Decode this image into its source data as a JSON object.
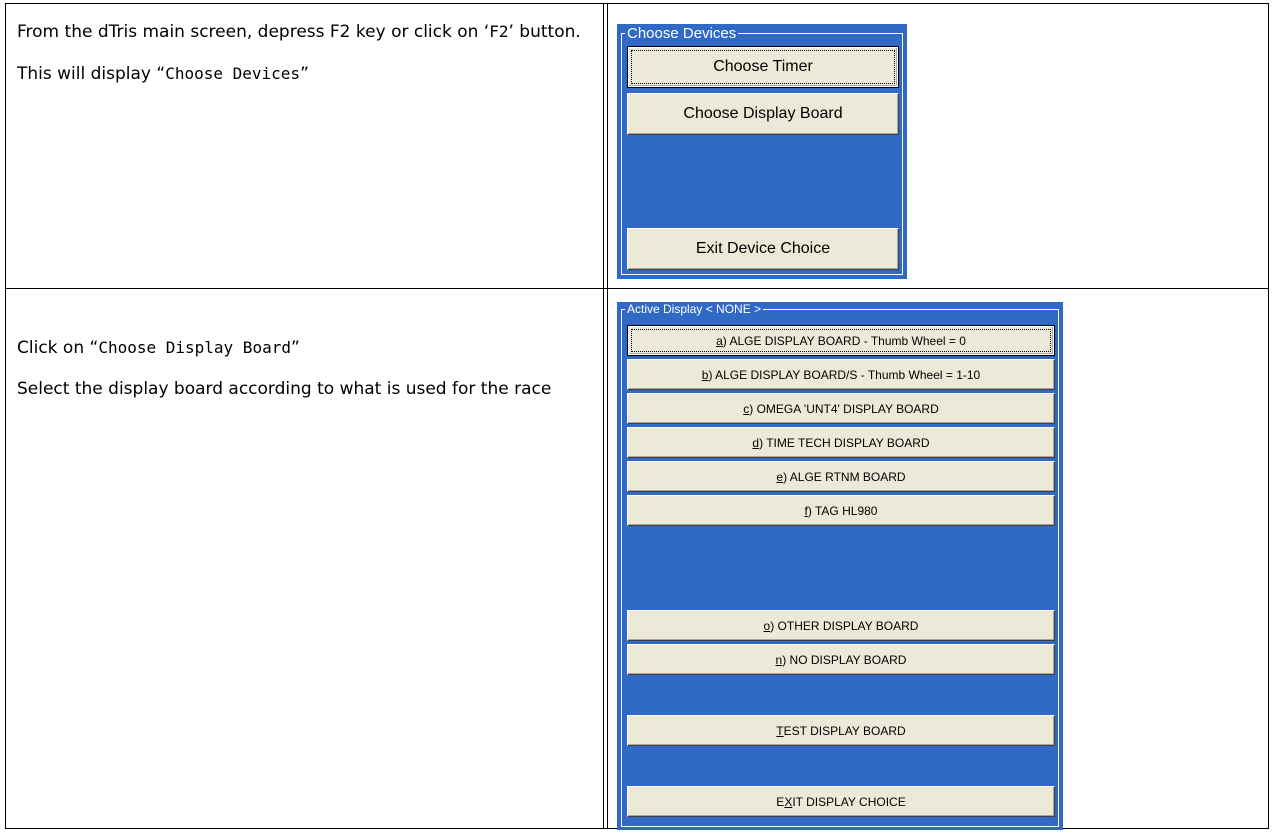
{
  "rows": [
    {
      "instructions": {
        "line1": "From the dTris main screen, depress F2 key or click on ‘",
        "key_code": "F2",
        "line1_end": "’ button.",
        "line2_prefix": "This will display “",
        "choose_devices_code": "Choose Devices",
        "line2_suffix": "”"
      },
      "panel": {
        "group_title": "Choose Devices",
        "buttons": {
          "choose_timer": "Choose Timer",
          "choose_display_board": "Choose Display Board",
          "exit_device_choice": "Exit Device Choice"
        }
      }
    },
    {
      "instructions": {
        "click_prefix": "Click on “",
        "click_code": "Choose Display Board",
        "click_suffix": "”",
        "select_text": "Select the display board according to what is used for the race"
      },
      "panel": {
        "group_title": "Active Display < NONE  >",
        "buttons": [
          {
            "hotkey": "a",
            "label": ") ALGE DISPLAY BOARD - Thumb Wheel = 0"
          },
          {
            "hotkey": "b",
            "label": ") ALGE DISPLAY BOARD/S - Thumb Wheel = 1-10"
          },
          {
            "hotkey": "c",
            "label": ") OMEGA 'UNT4' DISPLAY BOARD"
          },
          {
            "hotkey": "d",
            "label": ") TIME TECH DISPLAY BOARD"
          },
          {
            "hotkey": "e",
            "label": ") ALGE RTNM BOARD"
          },
          {
            "hotkey": "f",
            "label": ") TAG HL980"
          },
          {
            "hotkey": "o",
            "label": ") OTHER DISPLAY BOARD"
          },
          {
            "hotkey": "n",
            "label": ") NO DISPLAY BOARD"
          },
          {
            "hotkey": "T",
            "label": "EST DISPLAY BOARD"
          },
          {
            "hotkey_prefix": "E",
            "hotkey": "X",
            "label": "IT DISPLAY CHOICE"
          }
        ]
      }
    }
  ],
  "colors": {
    "panel_blue": "#3169c6",
    "button_face": "#ece9d8",
    "border": "#000000"
  }
}
